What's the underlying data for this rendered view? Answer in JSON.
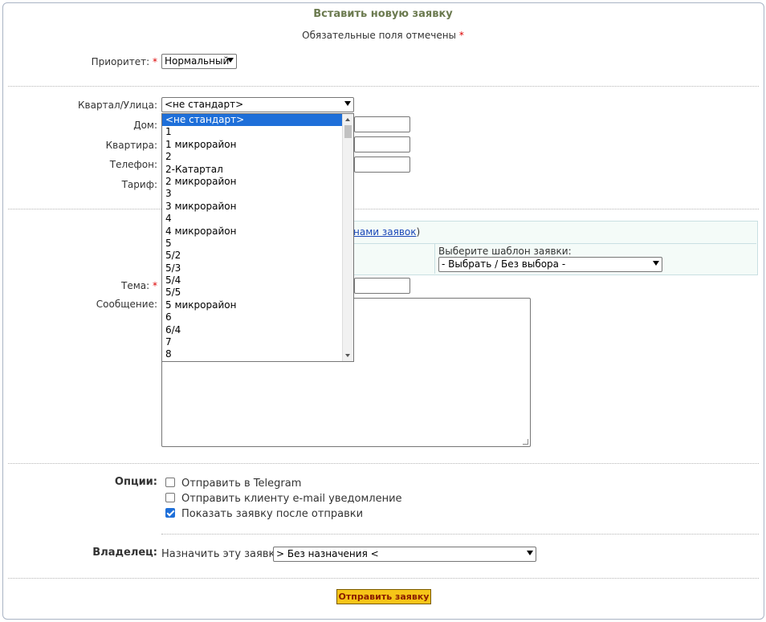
{
  "form": {
    "title": "Вставить новую заявку",
    "required_note": "Обязательные поля отмечены",
    "required_mark": "*"
  },
  "priority": {
    "label": "Приоритет:",
    "value": "Нормальный"
  },
  "address": {
    "street_label": "Квартал/Улица:",
    "street_value": "<не стандарт>",
    "house_label": "Дом:",
    "apartment_label": "Квартира:",
    "phone_label": "Телефон:",
    "tariff_label": "Тариф:"
  },
  "street_dropdown": {
    "options": [
      "<не стандарт>",
      "1",
      "1 микрорайон",
      "2",
      "2-Катартал",
      "2 микрорайон",
      "3",
      "3 микрорайон",
      "4",
      "4 микрорайон",
      "5",
      "5/2",
      "5/3",
      "5/4",
      "5/5",
      "5 микрорайон",
      "6",
      "6/4",
      "7",
      "8"
    ],
    "selected_index": 0
  },
  "templates": {
    "link_text": "нами заявок",
    "link_close": ")",
    "select_label": "Выберите шаблон заявки:",
    "select_value": "- Выбрать / Без выбора -"
  },
  "message": {
    "subject_label": "Тема:",
    "body_label": "Сообщение:"
  },
  "options": {
    "label": "Опции:",
    "items": [
      {
        "text": "Отправить в Telegram",
        "checked": false
      },
      {
        "text": "Отправить клиенту e-mail уведомление",
        "checked": false
      },
      {
        "text": "Показать заявку после отправки",
        "checked": true
      }
    ]
  },
  "owner": {
    "label": "Владелец:",
    "assign_text": "Назначить эту заявку",
    "value": "> Без назначения <"
  },
  "submit_label": "Отправить заявку",
  "colors": {
    "title": "#6b7a4f",
    "required": "#dd0000",
    "submit_bg": "#f5c518",
    "selection": "#1e6fd9",
    "link": "#1a47b8"
  }
}
